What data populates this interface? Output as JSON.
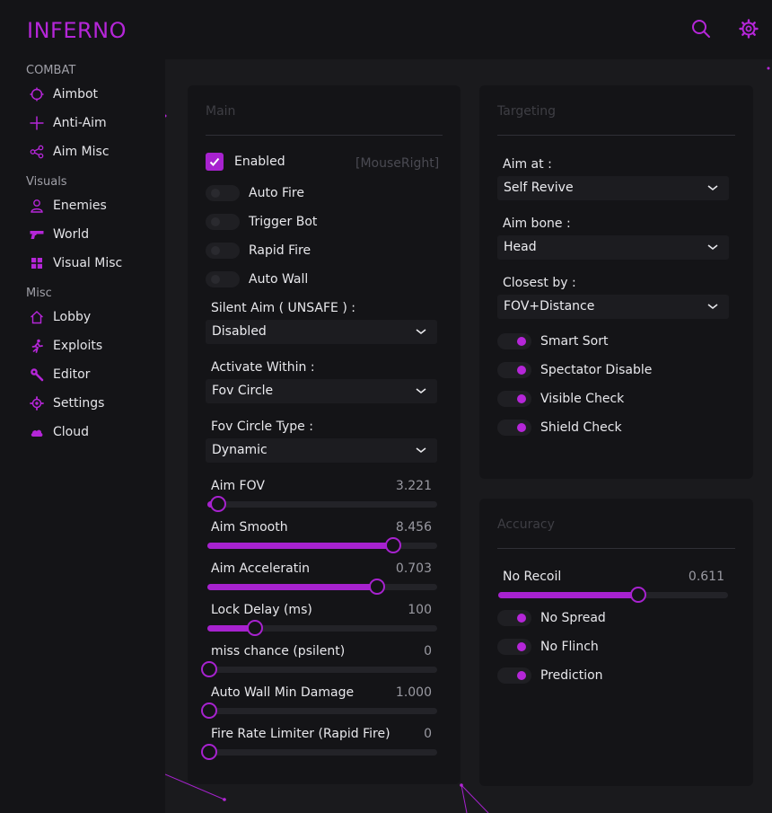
{
  "app": {
    "title": "INFERNO",
    "accent": "#a722cf"
  },
  "header": {
    "icons": [
      "search-icon",
      "gear-icon"
    ]
  },
  "sidebar": {
    "sections": [
      {
        "title": "COMBAT",
        "items": [
          {
            "label": "Aimbot",
            "icon": "crosshair-icon"
          },
          {
            "label": "Anti-Aim",
            "icon": "plus-icon"
          },
          {
            "label": "Aim Misc",
            "icon": "share-icon"
          }
        ]
      },
      {
        "title": "Visuals",
        "items": [
          {
            "label": "Enemies",
            "icon": "user-icon"
          },
          {
            "label": "World",
            "icon": "gun-icon"
          },
          {
            "label": "Visual Misc",
            "icon": "grid-icon"
          }
        ]
      },
      {
        "title": "Misc",
        "items": [
          {
            "label": "Lobby",
            "icon": "home-icon"
          },
          {
            "label": "Exploits",
            "icon": "running-icon"
          },
          {
            "label": "Editor",
            "icon": "wrench-icon"
          },
          {
            "label": "Settings",
            "icon": "gear-icon"
          },
          {
            "label": "Cloud",
            "icon": "cloud-icon"
          }
        ]
      }
    ]
  },
  "main_panel": {
    "title": "Main",
    "enabled": {
      "label": "Enabled",
      "checked": true,
      "keybind": "[MouseRight]"
    },
    "toggles": [
      {
        "label": "Auto Fire",
        "on": false
      },
      {
        "label": "Trigger Bot",
        "on": false
      },
      {
        "label": "Rapid Fire",
        "on": false
      },
      {
        "label": "Auto Wall",
        "on": false
      }
    ],
    "selects": [
      {
        "label": "Silent Aim ( UNSAFE ) :",
        "value": "Disabled"
      },
      {
        "label": "Activate Within :",
        "value": "Fov Circle"
      },
      {
        "label": "Fov Circle Type :",
        "value": "Dynamic"
      }
    ],
    "sliders": [
      {
        "label": "Aim FOV",
        "value": "3.221",
        "fraction": 0.04
      },
      {
        "label": "Aim Smooth",
        "value": "8.456",
        "fraction": 0.8
      },
      {
        "label": "Aim Acceleratin",
        "value": "0.703",
        "fraction": 0.73
      },
      {
        "label": "Lock Delay (ms)",
        "value": "100",
        "fraction": 0.2
      },
      {
        "label": "miss chance (psilent)",
        "value": "0",
        "fraction": 0.0
      },
      {
        "label": "Auto Wall Min Damage",
        "value": "1.000",
        "fraction": 0.0
      },
      {
        "label": "Fire Rate Limiter (Rapid Fire)",
        "value": "0",
        "fraction": 0.0
      }
    ]
  },
  "targeting_panel": {
    "title": "Targeting",
    "selects": [
      {
        "label": "Aim at :",
        "value": "Self Revive"
      },
      {
        "label": "Aim bone :",
        "value": "Head"
      },
      {
        "label": "Closest by :",
        "value": "FOV+Distance"
      }
    ],
    "toggles": [
      {
        "label": "Smart Sort",
        "on": true
      },
      {
        "label": "Spectator Disable",
        "on": true
      },
      {
        "label": "Visible Check",
        "on": true
      },
      {
        "label": "Shield Check",
        "on": true
      }
    ]
  },
  "accuracy_panel": {
    "title": "Accuracy",
    "slider": {
      "label": "No Recoil",
      "value": "0.611",
      "fraction": 0.6
    },
    "toggles": [
      {
        "label": "No Spread",
        "on": true
      },
      {
        "label": "No Flinch",
        "on": true
      },
      {
        "label": "Prediction",
        "on": true
      }
    ]
  }
}
